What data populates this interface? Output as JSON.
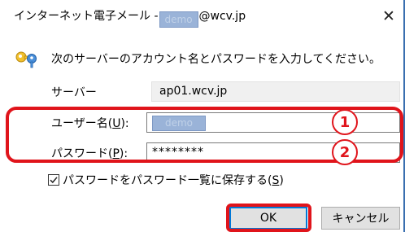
{
  "window": {
    "title_prefix": "インターネット電子メール -",
    "title_redacted": "demo",
    "title_suffix": "@wcv.jp",
    "close_glyph": "✕"
  },
  "prompt": {
    "icon": "keys-icon",
    "text": "次のサーバーのアカウント名とパスワードを入力してください。"
  },
  "fields": {
    "server_label": "サーバー",
    "server_value": "ap01.wcv.jp",
    "user_label_prefix": "ユーザー名(",
    "user_label_key": "U",
    "user_label_suffix": "):",
    "user_value_redacted": "demo",
    "password_label_prefix": "パスワード(",
    "password_label_key": "P",
    "password_label_suffix": "):",
    "password_value": "********"
  },
  "checkbox": {
    "checked": true,
    "label_prefix": "パスワードをパスワード一覧に保存する(",
    "label_key": "S",
    "label_suffix": ")"
  },
  "buttons": {
    "ok": "OK",
    "cancel": "キャンセル"
  },
  "annotations": {
    "badge_1": "1",
    "badge_2": "2",
    "highlight_color": "#e0141b"
  }
}
